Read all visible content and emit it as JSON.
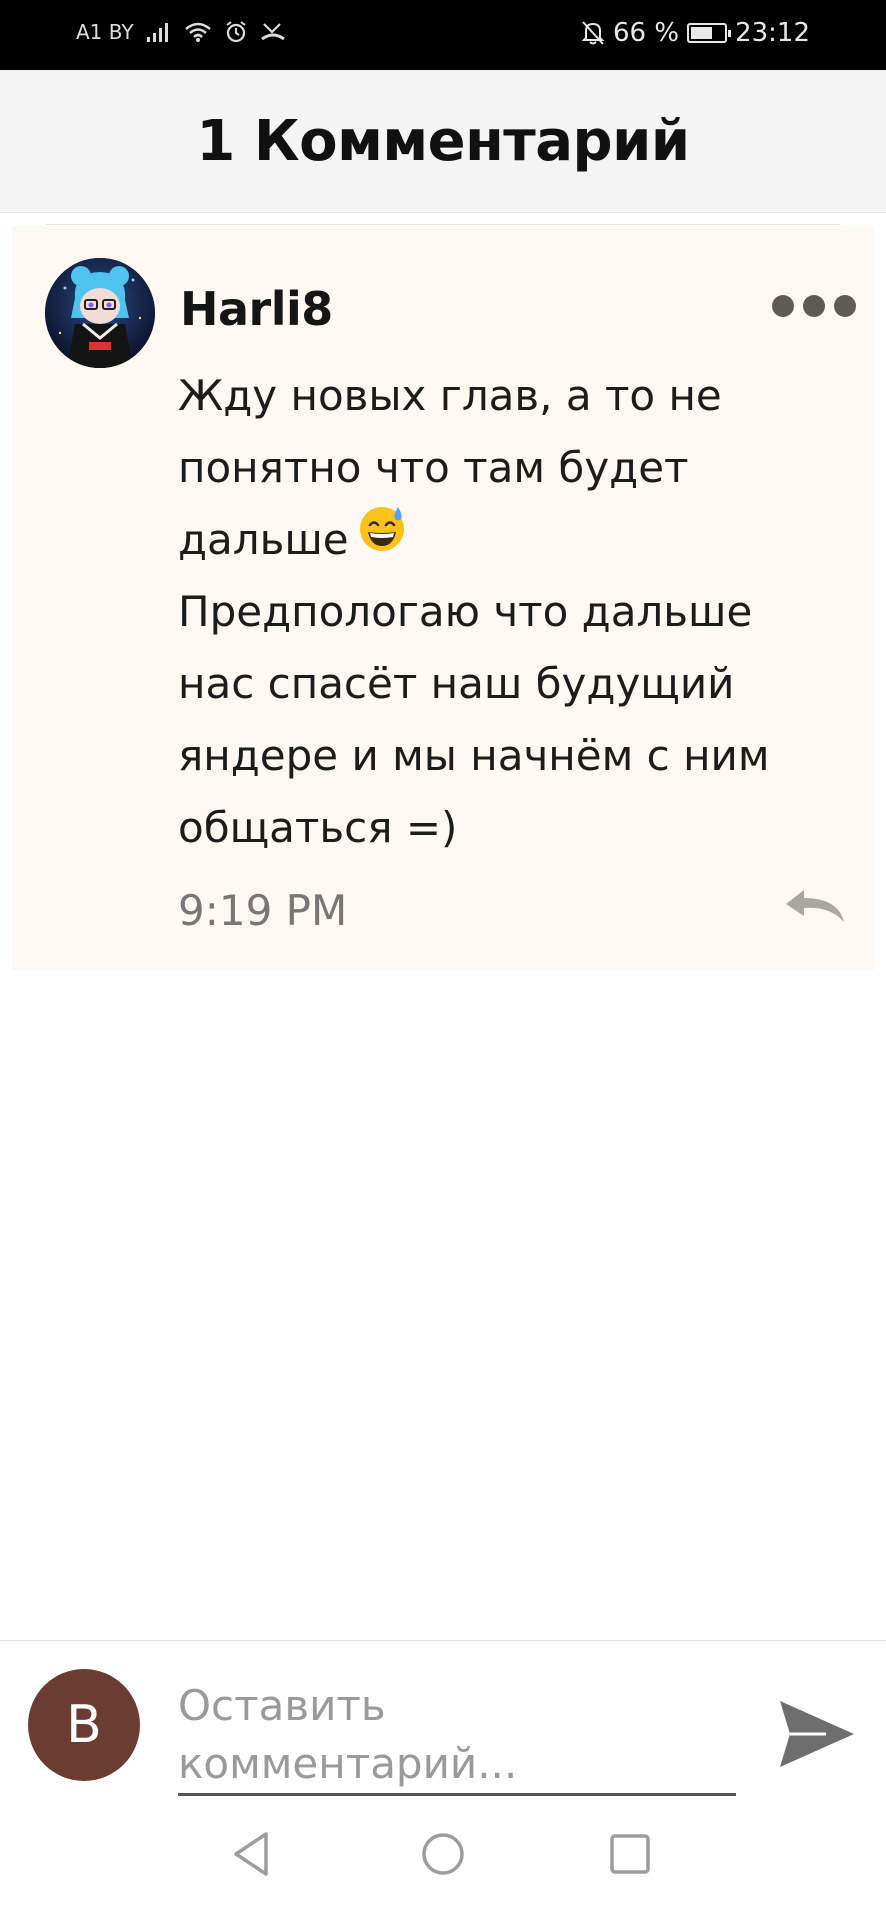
{
  "status_bar": {
    "carrier": "A1 BY",
    "battery_percent": "66 %",
    "battery_level": 0.66,
    "time": "23:12",
    "icons": [
      "signal-icon",
      "wifi-icon",
      "alarm-icon",
      "missed-call-icon",
      "bell-muted-icon",
      "battery-icon"
    ]
  },
  "header": {
    "title": "1 Комментарий"
  },
  "comment": {
    "author": "Harli8",
    "text_lines": [
      "Жду новых глав, а то не",
      "понятно что там будет",
      "дальше",
      "Предпологаю что дальше",
      "нас спасёт наш будущий",
      "яндере и мы начнём с ним",
      "общаться =)"
    ],
    "emoji": "😅",
    "time": "9:19 PM"
  },
  "composer": {
    "user_initial": "B",
    "placeholder": "Оставить комментарий...",
    "avatar_color": "#6b3d32"
  },
  "colors": {
    "card_background": "#fdf8f2",
    "header_background": "#f4f4f4",
    "status_bar": "#000000"
  }
}
